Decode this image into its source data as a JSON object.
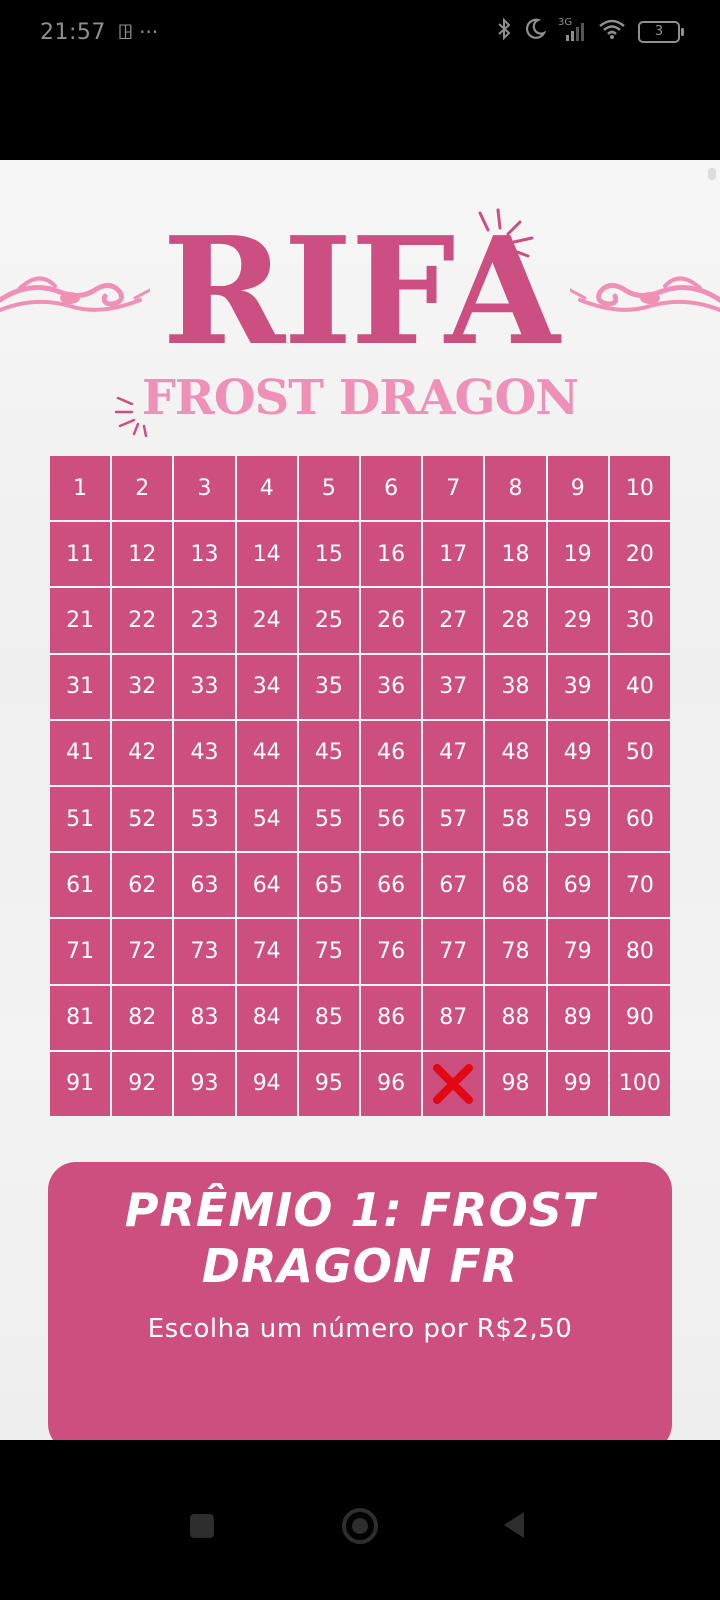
{
  "status_bar": {
    "time": "21:57",
    "left_icons": "ꖸ ···",
    "network": "3G",
    "battery_level": "3"
  },
  "raffle": {
    "title": "RIFA",
    "subtitle": "FROST DRAGON",
    "numbers": [
      "1",
      "2",
      "3",
      "4",
      "5",
      "6",
      "7",
      "8",
      "9",
      "10",
      "11",
      "12",
      "13",
      "14",
      "15",
      "16",
      "17",
      "18",
      "19",
      "20",
      "21",
      "22",
      "23",
      "24",
      "25",
      "26",
      "27",
      "28",
      "29",
      "30",
      "31",
      "32",
      "33",
      "34",
      "35",
      "36",
      "37",
      "38",
      "39",
      "40",
      "41",
      "42",
      "43",
      "44",
      "45",
      "46",
      "47",
      "48",
      "49",
      "50",
      "51",
      "52",
      "53",
      "54",
      "55",
      "56",
      "57",
      "58",
      "59",
      "60",
      "61",
      "62",
      "63",
      "64",
      "65",
      "66",
      "67",
      "68",
      "69",
      "70",
      "71",
      "72",
      "73",
      "74",
      "75",
      "76",
      "77",
      "78",
      "79",
      "80",
      "81",
      "82",
      "83",
      "84",
      "85",
      "86",
      "87",
      "88",
      "89",
      "90",
      "91",
      "92",
      "93",
      "94",
      "95",
      "96",
      "97",
      "98",
      "99",
      "100"
    ],
    "taken_numbers": [
      97
    ],
    "primary_color": "#cc4f80",
    "accent_color": "#ef90b6",
    "taken_mark_color": "#e30613"
  },
  "prize": {
    "title": "PRÊMIO 1: FROST DRAGON FR",
    "description": "Escolha um número por R$2,50"
  },
  "nav_bar": {
    "icons": [
      "recents-square-icon",
      "home-circle-icon",
      "back-triangle-icon"
    ]
  }
}
